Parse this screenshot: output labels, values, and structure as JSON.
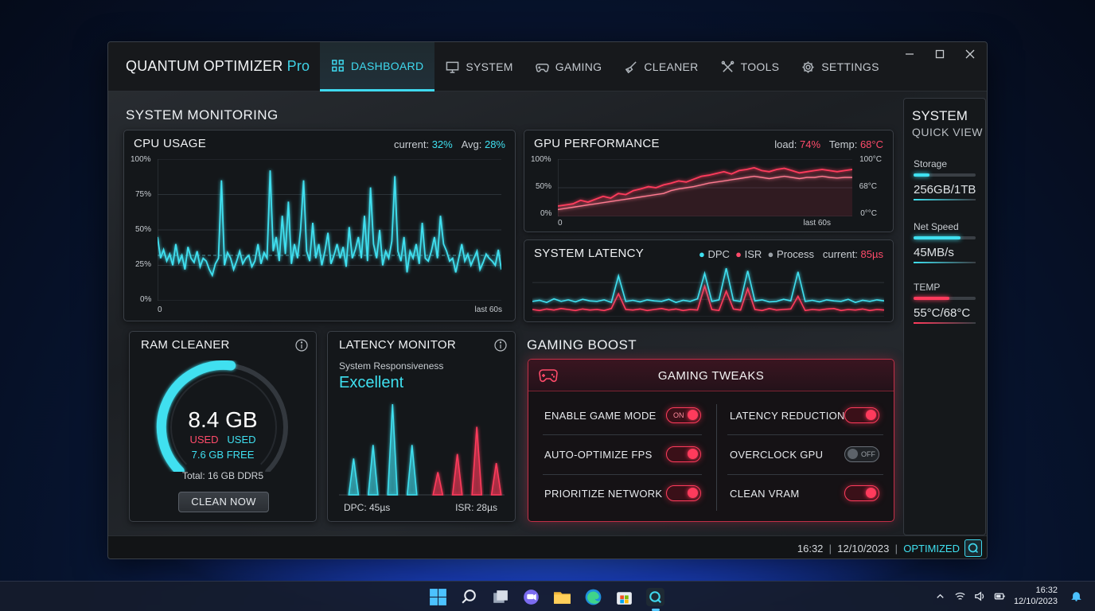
{
  "app": {
    "title_main": "QUANTUM OPTIMIZER",
    "title_suffix": "Pro"
  },
  "nav": [
    {
      "label": "DASHBOARD",
      "icon": "grid-icon",
      "active": true
    },
    {
      "label": "SYSTEM",
      "icon": "monitor-icon"
    },
    {
      "label": "GAMING",
      "icon": "gamepad-icon"
    },
    {
      "label": "CLEANER",
      "icon": "broom-icon"
    },
    {
      "label": "TOOLS",
      "icon": "tools-icon"
    },
    {
      "label": "SETTINGS",
      "icon": "gear-icon"
    }
  ],
  "monitoring": {
    "title": "SYSTEM MONITORING"
  },
  "cpu": {
    "title": "CPU USAGE",
    "current_label": "current:",
    "current": "32%",
    "avg_label": "Avg:",
    "avg": "28%",
    "y_ticks": [
      "100%",
      "75%",
      "50%",
      "25%",
      "0%"
    ],
    "x_start": "0",
    "x_end": "last 60s",
    "avg_line": 32,
    "values": [
      45,
      30,
      36,
      28,
      33,
      25,
      40,
      27,
      32,
      22,
      38,
      30,
      27,
      35,
      24,
      30,
      28,
      22,
      18,
      26,
      30,
      85,
      25,
      34,
      30,
      22,
      28,
      35,
      26,
      30,
      32,
      24,
      28,
      40,
      26,
      34,
      30,
      92,
      35,
      45,
      28,
      60,
      33,
      70,
      26,
      40,
      30,
      50,
      85,
      35,
      28,
      55,
      30,
      40,
      25,
      35,
      48,
      26,
      32,
      40,
      30,
      38,
      24,
      52,
      30,
      36,
      45,
      30,
      60,
      28,
      80,
      40,
      30,
      50,
      25,
      35,
      30,
      42,
      88,
      35,
      28,
      45,
      20,
      35,
      30,
      40,
      26,
      55,
      30,
      28,
      35,
      45,
      30,
      60,
      40,
      35,
      28,
      30,
      20,
      30,
      40,
      28,
      33,
      25,
      30,
      35,
      22,
      27,
      33,
      30,
      28,
      25,
      36,
      22
    ]
  },
  "gpu": {
    "title": "GPU PERFORMANCE",
    "load_label": "load:",
    "load": "74%",
    "temp_label": "Temp:",
    "temp": "68°C",
    "y_ticks": [
      "100%",
      "50%",
      "0%"
    ],
    "y2_ticks": [
      "100°C",
      "68°C",
      "0°°C"
    ],
    "x_start": "0",
    "x_end": "last 60s",
    "load_values": [
      18,
      20,
      22,
      28,
      25,
      30,
      35,
      32,
      40,
      38,
      45,
      48,
      52,
      50,
      55,
      58,
      62,
      60,
      65,
      70,
      72,
      75,
      78,
      74,
      80,
      82,
      85,
      80,
      78,
      82,
      84,
      80,
      76,
      78,
      80,
      82,
      80,
      78,
      80,
      82
    ],
    "temp_values": [
      12,
      14,
      16,
      18,
      20,
      22,
      24,
      26,
      28,
      30,
      32,
      34,
      36,
      38,
      40,
      45,
      48,
      50,
      52,
      55,
      58,
      60,
      62,
      64,
      66,
      68,
      70,
      68,
      66,
      68,
      70,
      68,
      66,
      68,
      68,
      70,
      68,
      67,
      68,
      68
    ]
  },
  "latency": {
    "title": "SYSTEM LATENCY",
    "legend": [
      {
        "label": "DPC",
        "color": "#3fe0f0"
      },
      {
        "label": "ISR",
        "color": "#ff4b6a"
      },
      {
        "label": "Process",
        "color": "#9aa0a6"
      }
    ],
    "current_label": "current:",
    "current": "85µs",
    "dpc_values": [
      30,
      32,
      28,
      35,
      30,
      33,
      29,
      34,
      31,
      30,
      33,
      28,
      80,
      30,
      32,
      29,
      33,
      31,
      30,
      34,
      28,
      32,
      30,
      35,
      85,
      30,
      33,
      95,
      32,
      30,
      90,
      31,
      33,
      29,
      30,
      34,
      31,
      88,
      30,
      32,
      29,
      33,
      31,
      30,
      34,
      28,
      32,
      30,
      33,
      31
    ],
    "isr_values": [
      14,
      12,
      15,
      13,
      16,
      14,
      12,
      15,
      13,
      14,
      12,
      16,
      45,
      14,
      13,
      15,
      12,
      14,
      16,
      13,
      15,
      12,
      14,
      13,
      60,
      14,
      12,
      50,
      15,
      13,
      55,
      14,
      12,
      16,
      13,
      14,
      15,
      40,
      12,
      14,
      13,
      15,
      16,
      12,
      14,
      13,
      15,
      12,
      14,
      13
    ]
  },
  "ram": {
    "title": "RAM CLEANER",
    "value": "8.4 GB",
    "used_a": "USED",
    "used_b": "USED",
    "free": "7.6 GB FREE",
    "total": "Total: 16 GB DDR5",
    "button": "CLEAN NOW",
    "used_fraction": 0.525
  },
  "latmon": {
    "title": "LATENCY MONITOR",
    "sub": "System Responsiveness",
    "status": "Excellent",
    "dpc": "DPC: 45µs",
    "isr": "ISR: 28µs",
    "dpc_peaks": [
      40,
      55,
      100,
      55
    ],
    "isr_peaks": [
      25,
      45,
      75,
      35
    ]
  },
  "gaming": {
    "title": "GAMING BOOST",
    "panel_title": "GAMING TWEAKS",
    "tweaks": [
      {
        "label": "ENABLE GAME MODE",
        "state": "on",
        "state_text": "ON"
      },
      {
        "label": "LATENCY REDUCTION",
        "state": "on",
        "state_text": ""
      },
      {
        "label": "AUTO-OPTIMIZE FPS",
        "state": "on",
        "state_text": ""
      },
      {
        "label": "OVERCLOCK GPU",
        "state": "off",
        "state_text": "OFF"
      },
      {
        "label": "PRIORITIZE NETWORK",
        "state": "on",
        "state_text": ""
      },
      {
        "label": "CLEAN VRAM",
        "state": "on",
        "state_text": ""
      }
    ]
  },
  "quick": {
    "title": "SYSTEM",
    "sub": "QUICK VIEW",
    "storage_label": "Storage",
    "storage_value": "256GB/1TB",
    "storage_fraction": 0.25,
    "net_label": "Net Speed",
    "net_value": "45MB/s",
    "net_fraction": 0.75,
    "temp_label": "TEMP",
    "temp_value": "55°C/68°C",
    "temp_fraction": 0.58
  },
  "status": {
    "time": "16:32",
    "date": "12/10/2023",
    "state": "OPTIMIZED"
  },
  "taskbar": {
    "time": "16:32",
    "date": "12/10/2023"
  },
  "colors": {
    "cyan": "#3fe0f0",
    "red": "#ff3b5c"
  }
}
